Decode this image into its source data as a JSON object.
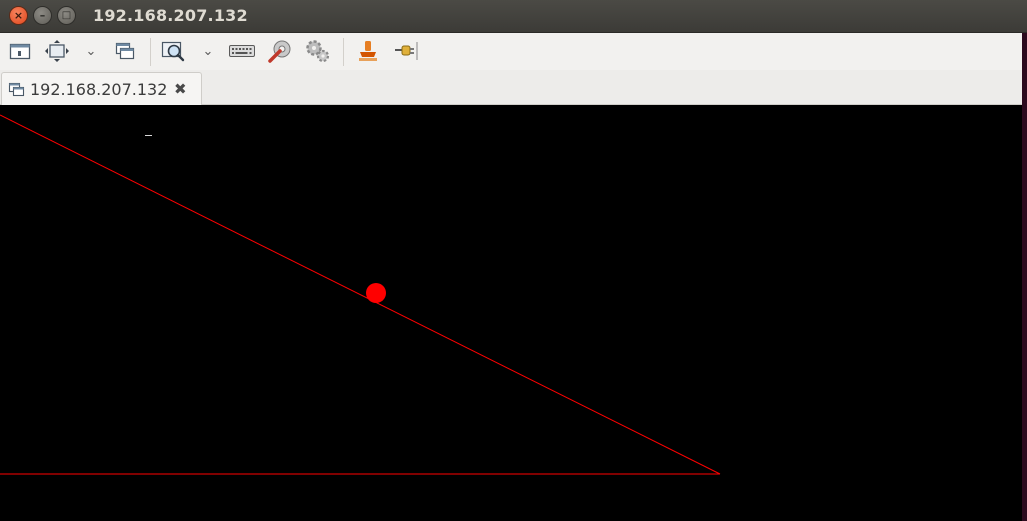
{
  "window": {
    "title": "192.168.207.132",
    "close_glyph": "×",
    "minimize_glyph": "–",
    "maximize_glyph": "□"
  },
  "toolbar": {
    "items": [
      {
        "icon": "window-icon"
      },
      {
        "icon": "fullscreen-icon"
      },
      {
        "icon": "chevron-down-icon"
      },
      {
        "icon": "multi-window-icon"
      },
      {
        "icon": "zoom-icon"
      },
      {
        "icon": "chevron-down-icon"
      },
      {
        "icon": "keyboard-icon"
      },
      {
        "icon": "preferences-icon"
      },
      {
        "icon": "settings-gears-icon"
      },
      {
        "icon": "screenshot-icon"
      },
      {
        "icon": "disconnect-icon"
      }
    ],
    "dropdown_glyph": "⌄"
  },
  "tabs": [
    {
      "label": "192.168.207.132",
      "close_glyph": "✖"
    }
  ],
  "remote_display": {
    "background": "#000000",
    "line_color": "#ff0000",
    "dot_color": "#ff0000"
  }
}
